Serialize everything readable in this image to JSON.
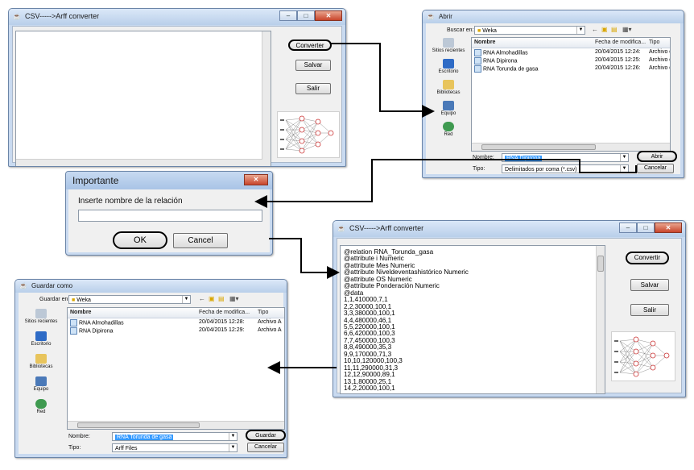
{
  "converter_small": {
    "title": "CSV----->Arff converter",
    "convert_label": "Converter",
    "save_label": "Salvar",
    "exit_label": "Salir"
  },
  "open_dialog": {
    "title": "Abrir",
    "look_in_label": "Buscar en:",
    "look_in_value": "Weka",
    "columns": [
      "Nombre",
      "Fecha de modifica...",
      "Tipo"
    ],
    "files": [
      {
        "name": "RNA Almohadillas",
        "date": "20/04/2015 12:24:",
        "type": "Archivo de"
      },
      {
        "name": "RNA Dipirona",
        "date": "20/04/2015 12:25:",
        "type": "Archivo de"
      },
      {
        "name": "RNA Torunda de gasa",
        "date": "20/04/2015 12:26:",
        "type": "Archivo de"
      }
    ],
    "places": [
      "Sitios recientes",
      "Escritorio",
      "Bibliotecas",
      "Equipo",
      "Red"
    ],
    "name_label": "Nombre:",
    "name_value": "RNA Dipirona",
    "type_label": "Tipo:",
    "type_value": "Delimitados por coma (*.csv)",
    "open_label": "Abrir",
    "cancel_label": "Cancelar"
  },
  "important_dialog": {
    "title": "Importante",
    "prompt": "Inserte nombre de la relación",
    "input_value": "",
    "ok_label": "OK",
    "cancel_label": "Cancel",
    "close_glyph": "✕"
  },
  "converter_large": {
    "title": "CSV----->Arff converter",
    "convert_label": "Convertir",
    "save_label": "Salvar",
    "exit_label": "Salir",
    "content_lines": [
      "@relation RNA_Torunda_gasa",
      "@attribute i Numeric",
      "@attribute Mes Numeric",
      "@attribute Niveldeventashistórico Numeric",
      "@attribute OS Numeric",
      "@attribute Ponderación Numeric",
      "@data",
      "1,1,410000,7,1",
      "2,2,30000,100,1",
      "3,3,380000,100,1",
      "4,4,480000,46,1",
      "5,5,220000,100,1",
      "6,6,420000,100,3",
      "7,7,450000,100,3",
      "8,8,490000,35,3",
      "9,9,170000,71,3",
      "10,10,120000,100,3",
      "11,11,290000,31,3",
      "12,12,90000,89,1",
      "13,1,80000,25,1",
      "14,2,20000,100,1"
    ]
  },
  "save_dialog": {
    "title": "Guardar como",
    "save_in_label": "Guardar en:",
    "save_in_value": "Weka",
    "columns": [
      "Nombre",
      "Fecha de modifica...",
      "Tipo"
    ],
    "files": [
      {
        "name": "RNA Almohadillas",
        "date": "20/04/2015 12:28:",
        "type": "Archivo A"
      },
      {
        "name": "RNA Dipirona",
        "date": "20/04/2015 12:29:",
        "type": "Archivo A"
      }
    ],
    "places": [
      "Sitios recientes",
      "Escritorio",
      "Bibliotecas",
      "Equipo",
      "Red"
    ],
    "name_label": "Nombre:",
    "name_value": "RNA Torunda de gasa",
    "type_label": "Tipo:",
    "type_value": "Arff Files",
    "save_label": "Guardar",
    "cancel_label": "Cancelar"
  },
  "colors": {
    "window_frame": "#c9daf0",
    "title_bar": "#b9cfea",
    "selection": "#3399ff",
    "close_button": "#c8452c"
  }
}
